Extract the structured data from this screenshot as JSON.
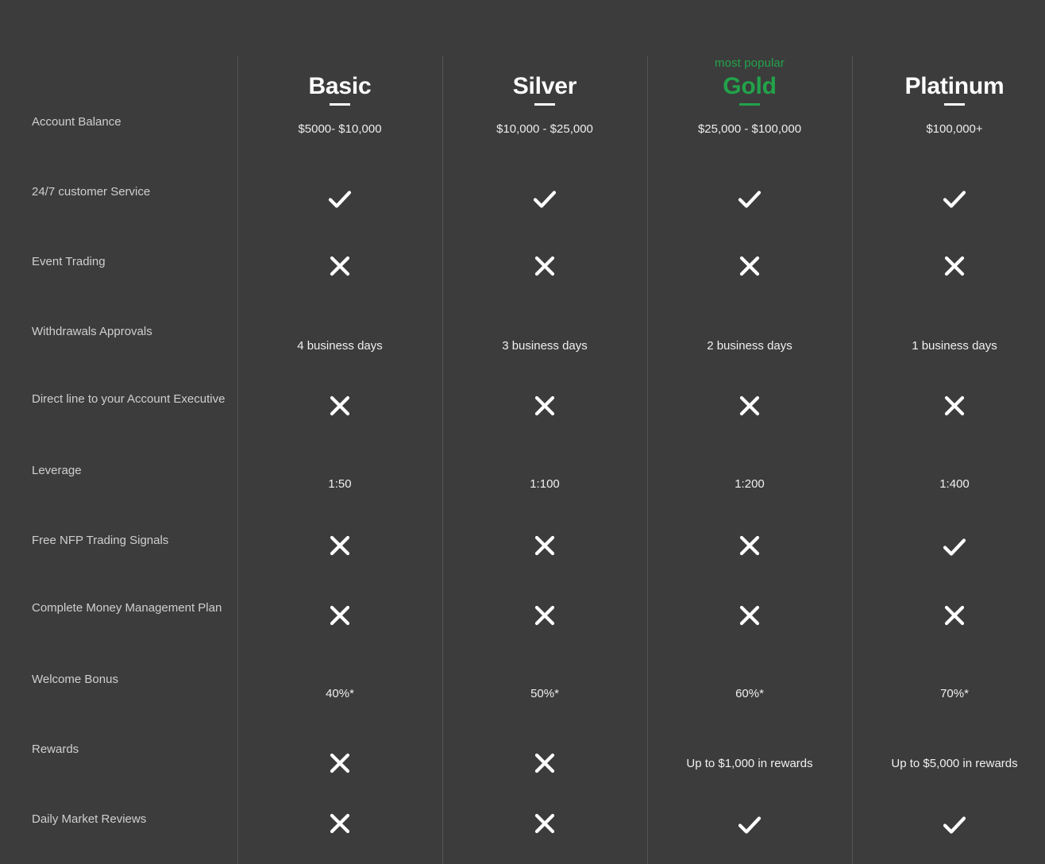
{
  "theme": {
    "background": "#3c3c3c",
    "divider": "#555555",
    "accent_green": "#22a34a",
    "text_primary": "#f0f0f0",
    "text_label": "#cfcfcf"
  },
  "plans": [
    {
      "name": "Basic",
      "badge": "",
      "price": "$5000- $10,000",
      "highlight": false
    },
    {
      "name": "Silver",
      "badge": "",
      "price": "$10,000 - $25,000",
      "highlight": false
    },
    {
      "name": "Gold",
      "badge": "most popular",
      "price": "$25,000 - $100,000",
      "highlight": true
    },
    {
      "name": "Platinum",
      "badge": "",
      "price": "$100,000+",
      "highlight": false
    }
  ],
  "features": [
    {
      "label": "Account Balance",
      "values": [
        "$5000- $10,000",
        "$10,000 - $25,000",
        "$25,000 - $100,000",
        "$100,000+"
      ]
    },
    {
      "label": "24/7 customer Service",
      "values": [
        "check",
        "check",
        "check",
        "check"
      ]
    },
    {
      "label": "Event Trading",
      "values": [
        "cross",
        "cross",
        "cross",
        "cross"
      ]
    },
    {
      "label": "Withdrawals Approvals",
      "values": [
        "4 business days",
        "3 business days",
        "2 business days",
        "1 business days"
      ]
    },
    {
      "label": "Direct line to your Account Executive",
      "values": [
        "cross",
        "cross",
        "cross",
        "cross"
      ]
    },
    {
      "label": "Leverage",
      "values": [
        "1:50",
        "1:100",
        "1:200",
        "1:400"
      ]
    },
    {
      "label": "Free NFP Trading Signals",
      "values": [
        "cross",
        "cross",
        "cross",
        "check"
      ]
    },
    {
      "label": "Complete Money Management Plan",
      "values": [
        "cross",
        "cross",
        "cross",
        "cross"
      ]
    },
    {
      "label": "Welcome Bonus",
      "values": [
        "40%*",
        "50%*",
        "60%*",
        "70%*"
      ]
    },
    {
      "label": "Rewards",
      "values": [
        "cross",
        "cross",
        "Up to $1,000 in rewards",
        "Up to $5,000 in rewards"
      ]
    },
    {
      "label": "Daily Market Reviews",
      "values": [
        "cross",
        "cross",
        "check",
        "check"
      ]
    }
  ],
  "icons": {
    "check": "check-icon",
    "cross": "cross-icon"
  },
  "layout": {
    "label_col_width": 299,
    "plan_col_width": 258,
    "label_tops": [
      140,
      228,
      316,
      404,
      489,
      579,
      667,
      752,
      842,
      930,
      1018
    ],
    "value_tops": [
      162,
      240,
      326,
      426,
      502,
      600,
      678,
      766,
      864,
      952,
      1028
    ]
  }
}
